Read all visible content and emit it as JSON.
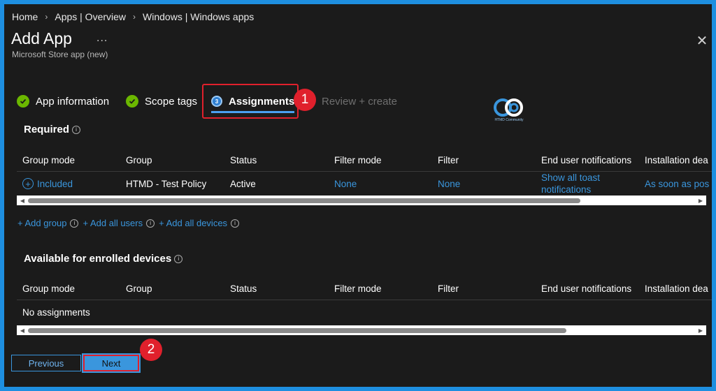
{
  "breadcrumb": [
    "Home",
    "Apps | Overview",
    "Windows | Windows apps"
  ],
  "header": {
    "title": "Add App",
    "more": "...",
    "subtitle": "Microsoft Store app (new)",
    "close": "✕"
  },
  "wizard": {
    "steps": [
      {
        "label": "App information",
        "state": "done"
      },
      {
        "label": "Scope tags",
        "state": "done"
      },
      {
        "label": "Assignments",
        "state": "active",
        "number": "3"
      },
      {
        "label": "Review + create",
        "state": "disabled"
      }
    ]
  },
  "callouts": [
    "1",
    "2"
  ],
  "logo": {
    "text": "HTMD Community",
    "mark": "HD"
  },
  "required": {
    "title": "Required",
    "columns": [
      "Group mode",
      "Group",
      "Status",
      "Filter mode",
      "Filter",
      "End user notifications",
      "Installation dea"
    ],
    "row": {
      "group_mode": "Included",
      "group": "HTMD - Test Policy",
      "status": "Active",
      "filter_mode": "None",
      "filter": "None",
      "notifications_line1": "Show all toast",
      "notifications_line2": "notifications",
      "installation_deadline": "As soon as pos"
    },
    "add_links": [
      "+ Add group",
      "+ Add all users",
      "+ Add all devices"
    ]
  },
  "available": {
    "title": "Available for enrolled devices",
    "columns": [
      "Group mode",
      "Group",
      "Status",
      "Filter mode",
      "Filter",
      "End user notifications",
      "Installation dea"
    ],
    "empty": "No assignments"
  },
  "footer": {
    "previous": "Previous",
    "next": "Next"
  },
  "colors": {
    "accent": "#3a96dd",
    "success": "#6bb700",
    "highlight": "#e0202c",
    "background": "#1b1b1b"
  }
}
